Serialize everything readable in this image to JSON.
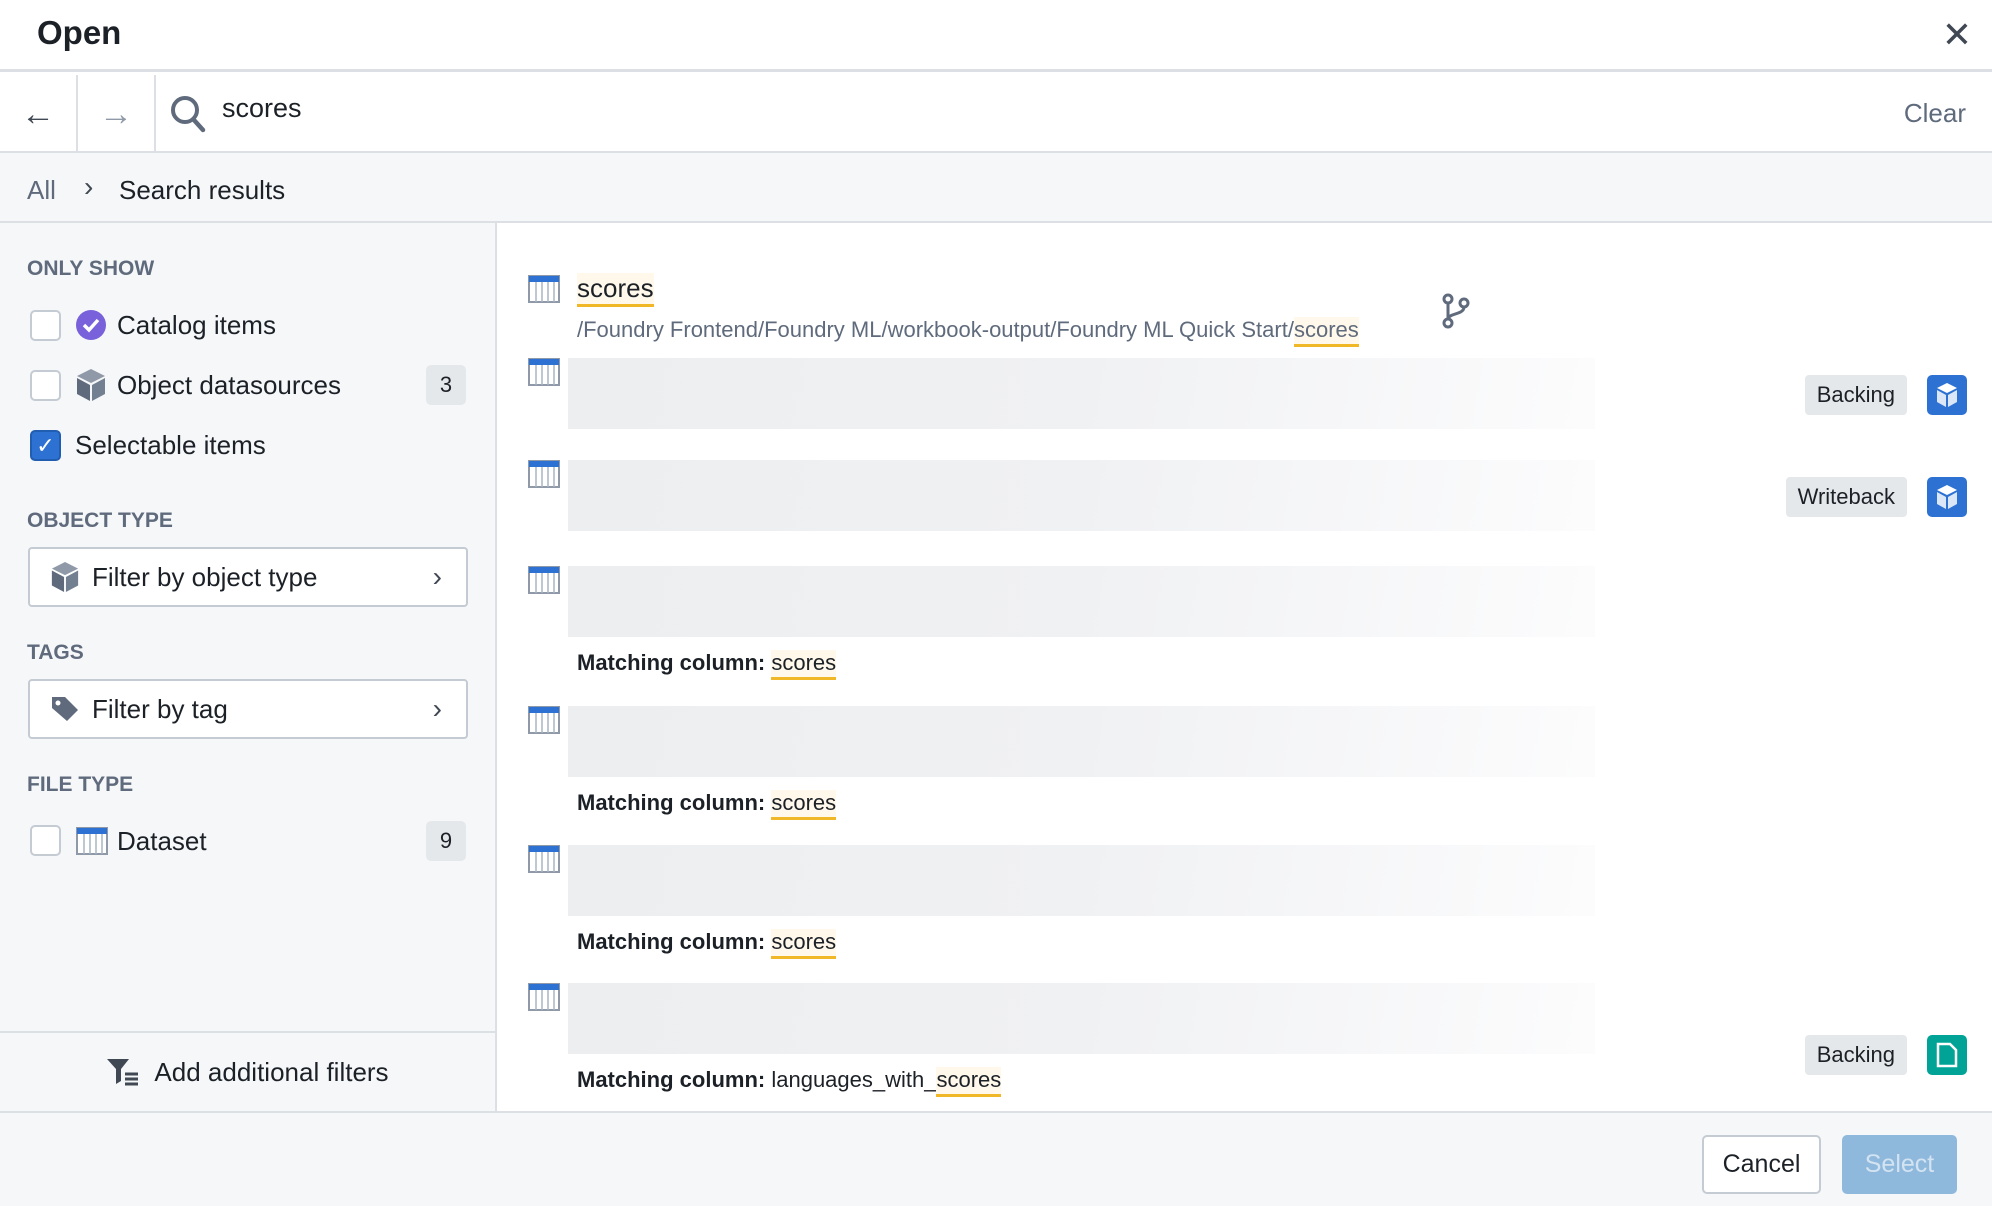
{
  "dialog": {
    "title": "Open",
    "close_icon": "close-icon"
  },
  "search": {
    "value": "scores",
    "clear_label": "Clear"
  },
  "breadcrumb": {
    "root": "All",
    "current": "Search results"
  },
  "sidebar": {
    "only_show_heading": "ONLY SHOW",
    "only_show": [
      {
        "label": "Catalog items",
        "checked": false,
        "icon": "verified-badge-icon"
      },
      {
        "label": "Object datasources",
        "checked": false,
        "icon": "cube-icon",
        "count": "3"
      },
      {
        "label": "Selectable items",
        "checked": true
      }
    ],
    "object_type_heading": "OBJECT TYPE",
    "object_type_button": "Filter by object type",
    "tags_heading": "TAGS",
    "tags_button": "Filter by tag",
    "file_type_heading": "FILE TYPE",
    "file_types": [
      {
        "label": "Dataset",
        "checked": false,
        "count": "9",
        "icon": "dataset-icon"
      }
    ],
    "add_filters": "Add additional filters"
  },
  "results": [
    {
      "title": "scores",
      "path_prefix": "/Foundry Frontend/Foundry ML/workbook-output/Foundry ML Quick Start/",
      "path_match": "scores",
      "icon": "branch-icon"
    },
    {
      "badge": "Backing",
      "type_icon": "object-cube-icon",
      "type_color": "#2d72d2"
    },
    {
      "badge": "Writeback",
      "type_icon": "object-cube-icon",
      "type_color": "#2d72d2"
    },
    {
      "match_label": "Matching column:",
      "match_prefix": "",
      "match": "scores"
    },
    {
      "match_label": "Matching column:",
      "match_prefix": "",
      "match": "scores"
    },
    {
      "match_label": "Matching column:",
      "match_prefix": "",
      "match": "scores"
    },
    {
      "match_label": "Matching column:",
      "match_prefix": "languages_with_",
      "match": "scores",
      "badge": "Backing",
      "type_icon": "file-icon",
      "type_color": "#00a396"
    }
  ],
  "footer": {
    "cancel": "Cancel",
    "select": "Select"
  },
  "colors": {
    "accent": "#2d72d2",
    "highlight": "#f0b726",
    "select_disabled": "#8fb9dc"
  }
}
